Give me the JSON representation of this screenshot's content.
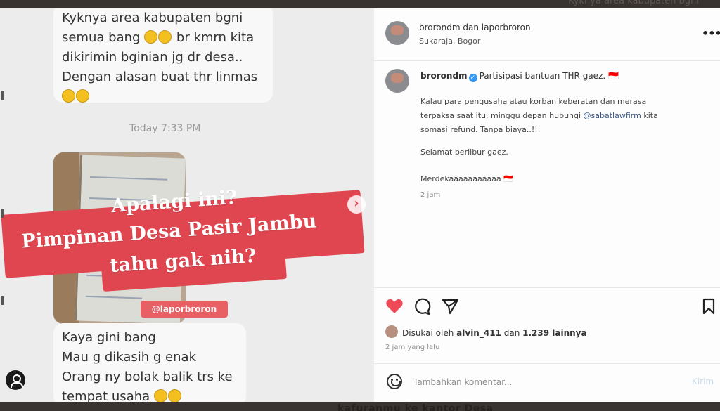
{
  "background": {
    "top_text": "Kyknya area kabupaten bgni",
    "bottom_text": "kafuranmu ke kantor Desa"
  },
  "chat": {
    "bubble1_lines": [
      "Kyknya area kabupaten bgni",
      "semua bang",
      "br kmrn kita",
      "dikirimin bginian jg dr desa..",
      "Dengan alasan buat thr linmas"
    ],
    "timestamp": "Today 7:33 PM",
    "watermark": "@laporbroron",
    "bubble2_lines": [
      "Kaya gini bang",
      "Mau g dikasih g enak",
      "Orang ny bolak balik trs ke",
      "tempat usaha"
    ]
  },
  "banner": {
    "line1": "Apalagi ini?",
    "line2": "Pimpinan Desa Pasir Jambu",
    "line3": "tahu gak nih?",
    "color": "#e04650"
  },
  "post": {
    "header": {
      "names": "brorondm dan laporbroron",
      "location": "Sukaraja, Bogor"
    },
    "caption": {
      "username": "brorondm",
      "first": "Partisipasi bantuan THR gaez. 🇮🇩",
      "p1_line1": "Kalau para pengusaha atau korban keberatan dan merasa",
      "p1_line2_a": "terpaksa saat itu, minggu depan hubungi ",
      "p1_mention": "@sabatlawfirm",
      "p1_line2_b": " kita",
      "p1_line3": "somasi refund. Tanpa biaya..!!",
      "p2": "Selamat berlibur gaez.",
      "p3": "Merdekaaaaaaaaaaa 🇮🇩",
      "time": "2 jam"
    },
    "likes": {
      "prefix": "Disukai oleh ",
      "user": "alvin_411",
      "middle": " dan ",
      "count": "1.239 lainnya"
    },
    "time_ago": "2 jam yang lalu",
    "comment_placeholder": "Tambahkan komentar...",
    "post_button": "Kirim",
    "heart_color": "#ed4956"
  }
}
